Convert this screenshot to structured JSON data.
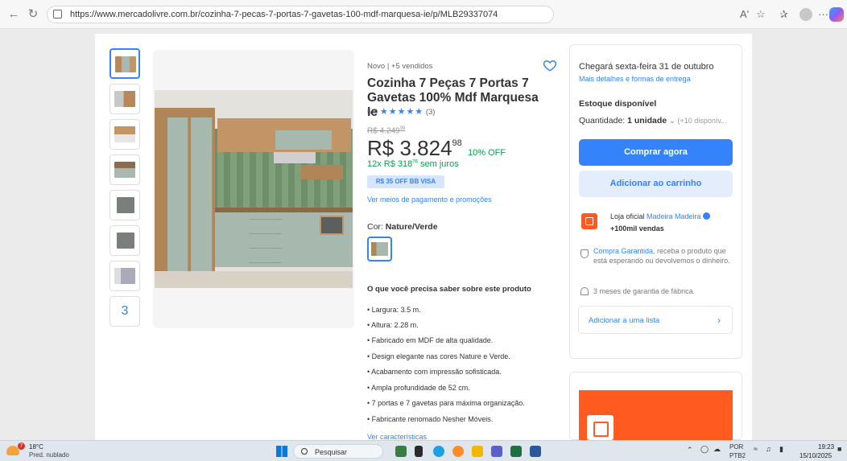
{
  "browser": {
    "url": "https://www.mercadolivre.com.br/cozinha-7-pecas-7-portas-7-gavetas-100-mdf-marquesa-ie/p/MLB29337074",
    "reader_label": "Aʹ",
    "more_label": "···"
  },
  "gallery": {
    "more_count": "3"
  },
  "product": {
    "meta": "Novo  |  +5 vendidos",
    "title": "Cozinha 7 Peças 7 Portas 7 Gavetas 100% Mdf Marquesa Ie",
    "rating_value": "5.0",
    "stars": "★★★★★",
    "rating_count": "(3)",
    "old_price": "R$ 4.249",
    "old_price_cents": "99",
    "price_int": "R$ 3.824",
    "price_cents": "98",
    "discount": "10% OFF",
    "installments": "12x R$ 318",
    "installments_cents": "76",
    "installments_suffix": " sem juros",
    "promo_badge": "R$ 35 OFF BB VISA",
    "payment_link": "Ver meios de pagamento e promoções",
    "color_prefix": "Cor: ",
    "color_value": "Nature/Verde",
    "features_title": "O que você precisa saber sobre este produto",
    "features": [
      "• Largura: 3.5 m.",
      "• Altura: 2.28 m.",
      "• Fabricado em MDF de alta qualidade.",
      "• Design elegante nas cores Nature e Verde.",
      "• Acabamento com impressão sofisticada.",
      "• Ampla profundidade de 52 cm.",
      "• 7 portas e 7 gavetas para máxima organização.",
      "• Fabricante renomado Nesher Móveis."
    ],
    "more_features": "Ver características"
  },
  "buybox": {
    "delivery": "Chegará sexta-feira 31 de outubro",
    "delivery_link": "Mais detalhes e formas de entrega",
    "stock": "Estoque disponível",
    "qty_label": "Quantidade: ",
    "qty_value": "1 unidade",
    "qty_more": "(+10 disponív...",
    "buy_now": "Comprar agora",
    "add_cart": "Adicionar ao carrinho",
    "store_prefix": "Loja oficial ",
    "store_name": "Madeira Madeira",
    "store_sales": "+100mil vendas",
    "guarantee_link": "Compra Garantida",
    "guarantee_text": ", receba o produto que está esperando ou devolvemos o dinheiro.",
    "warranty": "3 meses de garantia de fábrica.",
    "add_list": "Adicionar a uma lista"
  },
  "taskbar": {
    "weather_badge": "7",
    "temperature": "18°C",
    "weather": "Pred. nublado",
    "search": "Pesquisar",
    "lang_top": "POR",
    "lang_bottom": "PTB2",
    "time": "19:23",
    "date": "15/10/2025"
  },
  "colors": {
    "accent": "#3483fa",
    "green": "#00a650",
    "store_orange": "#ff5a1f"
  }
}
